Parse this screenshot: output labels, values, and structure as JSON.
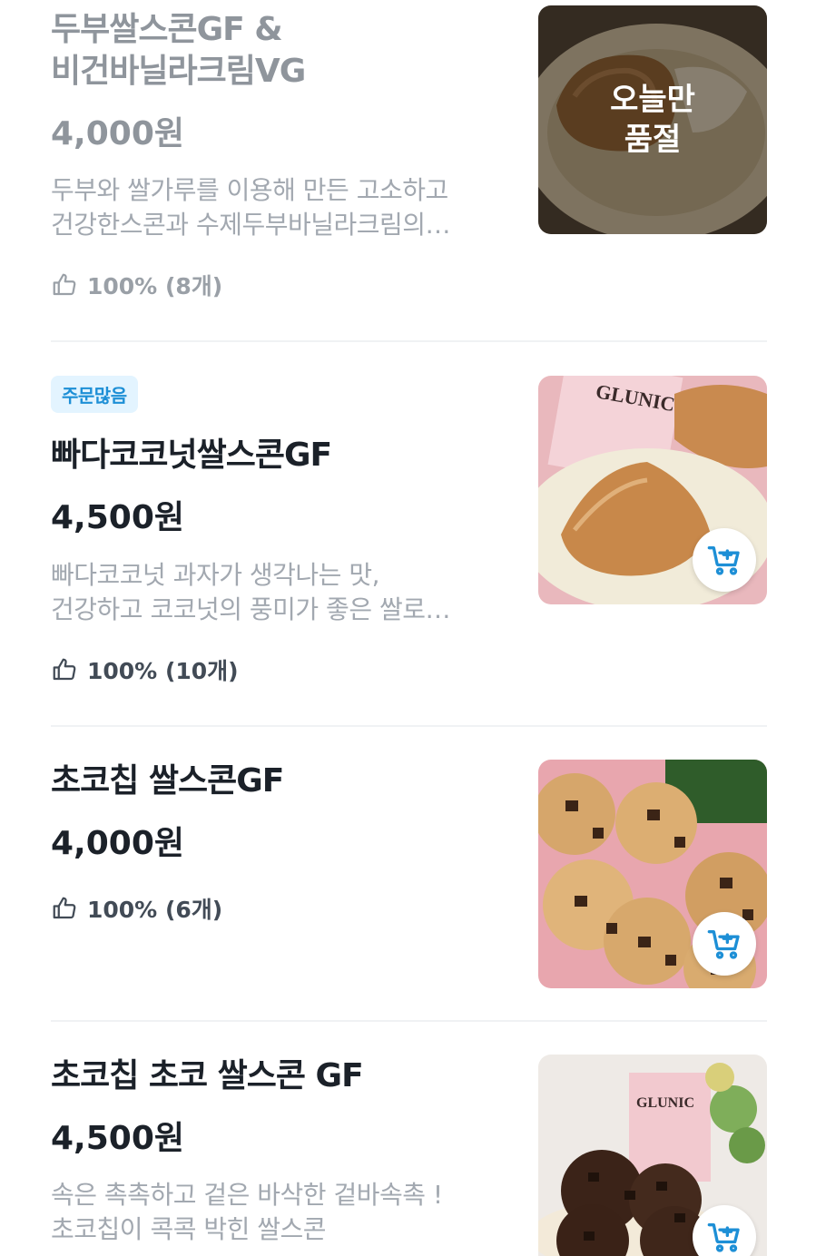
{
  "items": [
    {
      "name_line1": "두부쌀스콘GF &",
      "name_line2": "비건바닐라크림VG",
      "price": "4,000원",
      "desc_line1": "두부와 쌀가루를 이용해 만든 고소하고",
      "desc_line2": "건강한스콘과 수제두부바닐라크림의…",
      "rating": "100% (8개)",
      "sold_out_line1": "오늘만",
      "sold_out_line2": "품절"
    },
    {
      "badge": "주문많음",
      "name": "빠다코코넛쌀스콘GF",
      "price": "4,500원",
      "desc_line1": "빠다코코넛 과자가 생각나는 맛,",
      "desc_line2": "건강하고 코코넛의 풍미가 좋은 쌀로…",
      "rating": "100% (10개)"
    },
    {
      "name": "초코칩 쌀스콘GF",
      "price": "4,000원",
      "rating": "100% (6개)"
    },
    {
      "name": "초코칩 초코 쌀스콘 GF",
      "price": "4,500원",
      "desc_line1": "속은 촉촉하고 겉은 바삭한 겉바속촉 !",
      "desc_line2": "초코칩이 콕콕 박힌 쌀스콘"
    }
  ],
  "icons": {
    "rating": "thumbs-up-icon",
    "cart": "cart-plus-icon"
  },
  "colors": {
    "accent": "#1d8fd6",
    "badge_bg": "#e3f4ff",
    "text": "#1b2129",
    "muted": "#a2a8b0"
  }
}
